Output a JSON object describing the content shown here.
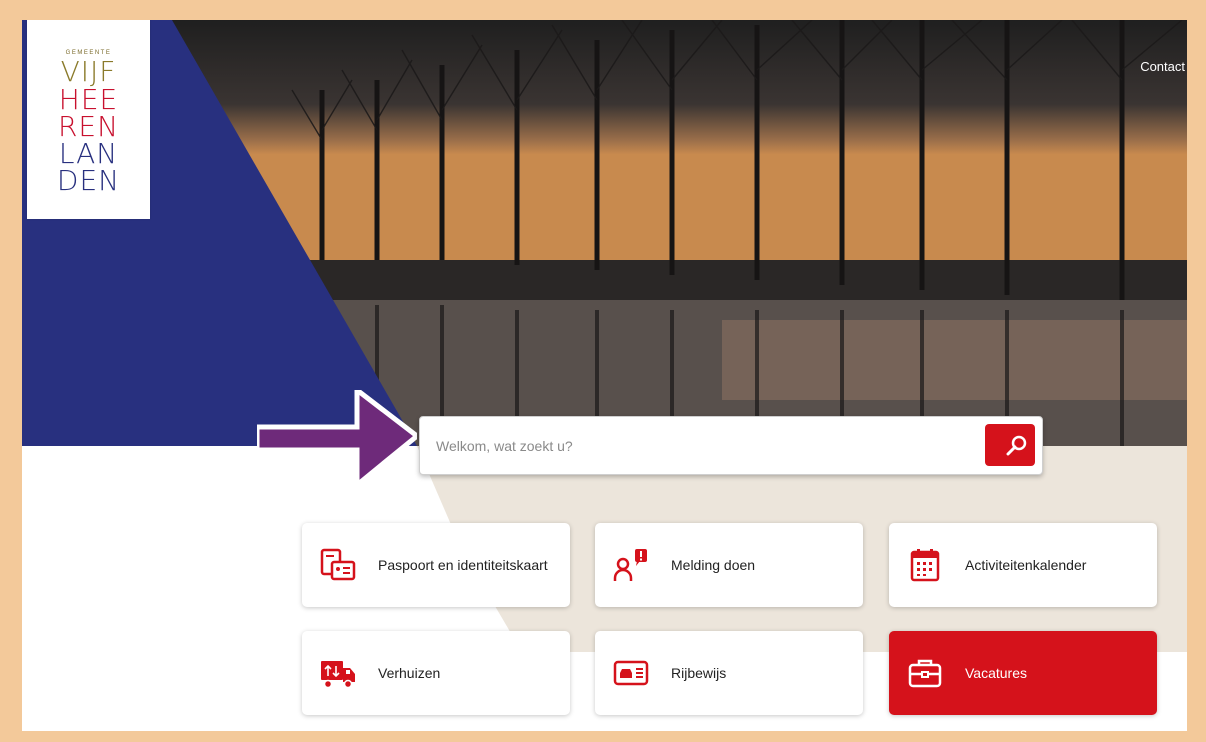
{
  "logo": {
    "small": "GEMEENTE",
    "lines": [
      "VIJF",
      "HEE",
      "REN",
      "LAN",
      "DEN"
    ]
  },
  "header": {
    "contact": "Contact"
  },
  "search": {
    "placeholder": "Welkom, wat zoekt u?"
  },
  "tiles": [
    {
      "label": "Paspoort en identiteitskaart",
      "icon": "passport-id-icon"
    },
    {
      "label": "Melding doen",
      "icon": "report-person-icon"
    },
    {
      "label": "Activiteitenkalender",
      "icon": "calendar-icon"
    },
    {
      "label": "Verhuizen",
      "icon": "moving-truck-icon"
    },
    {
      "label": "Rijbewijs",
      "icon": "drivers-license-icon"
    },
    {
      "label": "Vacatures",
      "icon": "briefcase-icon"
    }
  ],
  "colors": {
    "brand_red": "#d5121b",
    "brand_blue": "#28307f",
    "frame": "#f3c99a",
    "annotation_arrow": "#6e2a7a"
  }
}
